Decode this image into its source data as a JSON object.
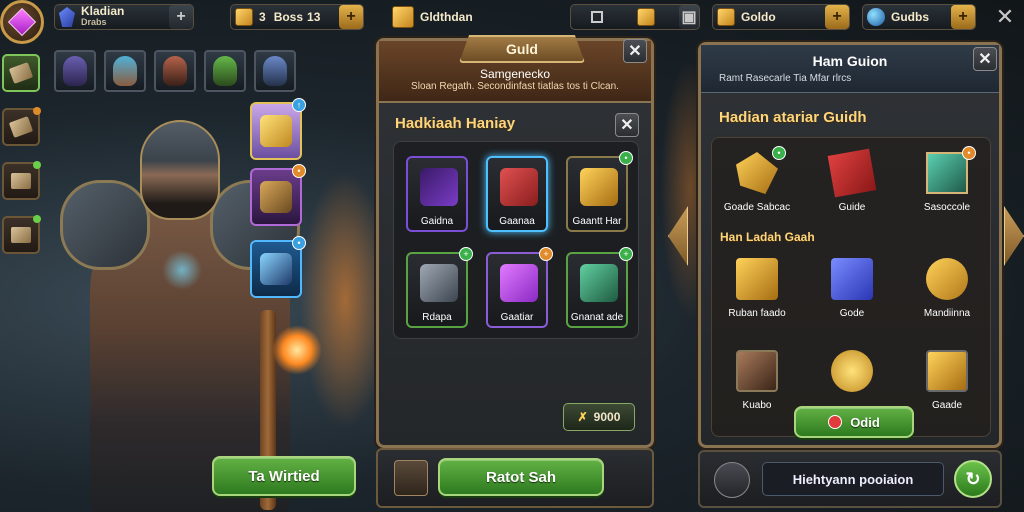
{
  "topbar": {
    "player_name": "Kladian",
    "player_sub": "Drabs",
    "currency1_amount": "3",
    "currency1_label": "Boss",
    "currency1_value": "13",
    "currency2_label": "Gldthdan",
    "currency3_label": "Goldo",
    "currency4_label": "Gudbs"
  },
  "left_menu": {
    "buttons": [
      "scroll",
      "chest",
      "crate",
      "box"
    ]
  },
  "hero": {
    "action_button": "Ta Wirtied"
  },
  "guild_panel": {
    "tab": "Guld",
    "banner_title": "Samgenecko",
    "banner_sub": "Sloan Regath. Secondinfast tiatlas tos ti Clcan.",
    "section": "Hadkiaah Haniay",
    "items": [
      {
        "label": "Gaidna",
        "color": "#9b5cff"
      },
      {
        "label": "Gaanaa",
        "color": "#4fc0ff"
      },
      {
        "label": "Gaantt Har",
        "color": "#c89a3a"
      },
      {
        "label": "Rdapa",
        "color": "#5aa342"
      },
      {
        "label": "Gaatiar",
        "color": "#8a5cd6"
      },
      {
        "label": "Gnanat ade",
        "color": "#5aa342"
      }
    ],
    "price": "9000",
    "footer_button": "Ratot Sah"
  },
  "right_panel": {
    "title": "Ham Guion",
    "subtitle": "Ramt Rasecarle Tia Mfar rlrcs",
    "section1": "Hadian atariar Guidh",
    "section2": "Han Ladah Gaah",
    "row1": [
      "Goade Sabcac",
      "Guide",
      "Sasoccole"
    ],
    "row2": [
      "Ruban faado",
      "Gode",
      "Mandiinna"
    ],
    "row3": [
      "Kuabo",
      "Gaade"
    ],
    "confirm_button": "Odid",
    "footer_field": "Hiehtyann pooiaion"
  }
}
